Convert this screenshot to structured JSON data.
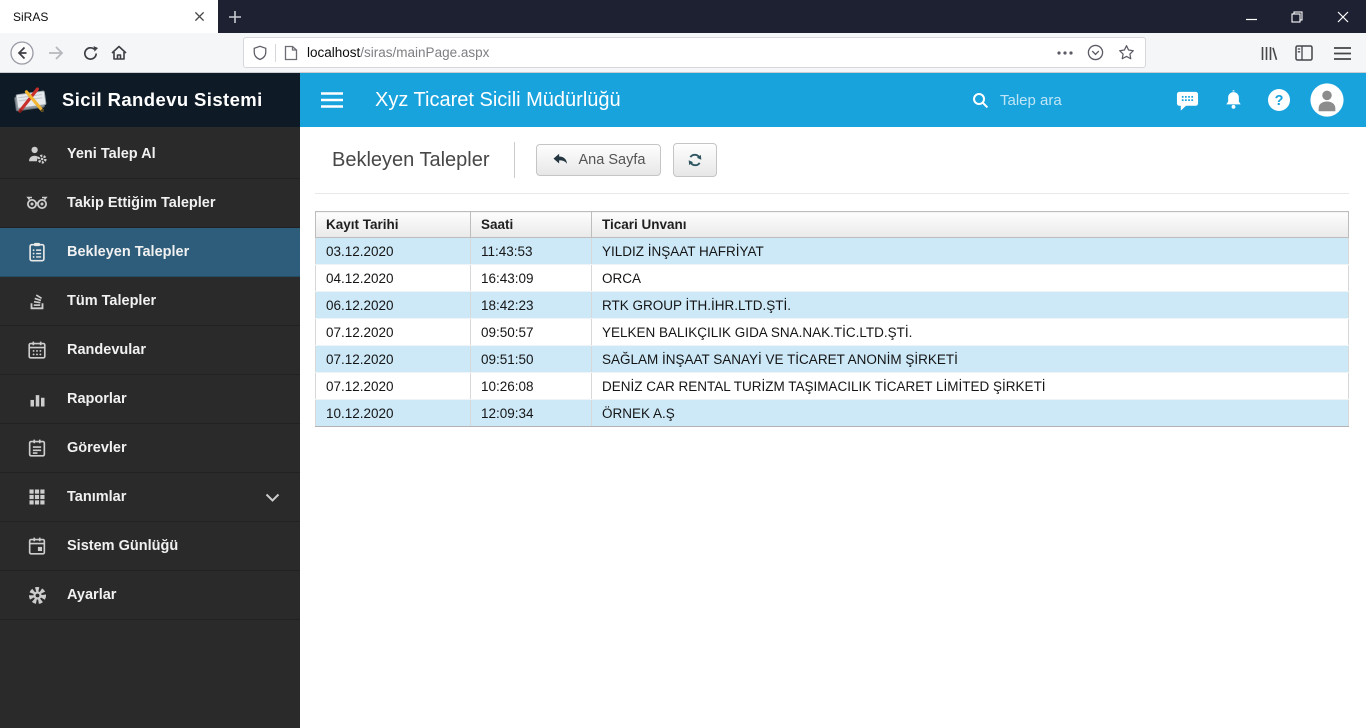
{
  "browser": {
    "tab_title": "SiRAS",
    "url": {
      "host": "localhost",
      "path": "/siras/mainPage.aspx"
    }
  },
  "appbar": {
    "title": "Xyz Ticaret Sicili Müdürlüğü",
    "search_placeholder": "Talep ara"
  },
  "sidebar": {
    "brand": "Sicil Randevu Sistemi",
    "items": [
      {
        "label": "Yeni Talep Al",
        "icon": "user-add-icon"
      },
      {
        "label": "Takip Ettiğim Talepler",
        "icon": "binoculars-icon"
      },
      {
        "label": "Bekleyen Talepler",
        "icon": "clipboard-list-icon",
        "active": true
      },
      {
        "label": "Tüm Talepler",
        "icon": "stack-icon"
      },
      {
        "label": "Randevular",
        "icon": "calendar-icon"
      },
      {
        "label": "Raporlar",
        "icon": "bar-chart-icon"
      },
      {
        "label": "Görevler",
        "icon": "tasks-icon"
      },
      {
        "label": "Tanımlar",
        "icon": "grid-icon",
        "expandable": true
      },
      {
        "label": "Sistem Günlüğü",
        "icon": "calendar-log-icon"
      },
      {
        "label": "Ayarlar",
        "icon": "gear-icon"
      }
    ]
  },
  "content": {
    "page_title": "Bekleyen Talepler",
    "home_button_label": "Ana Sayfa",
    "table": {
      "columns": [
        "Kayıt Tarihi",
        "Saati",
        "Ticari Unvanı"
      ],
      "rows": [
        [
          "03.12.2020",
          "11:43:53",
          "YILDIZ İNŞAAT HAFRİYAT"
        ],
        [
          "04.12.2020",
          "16:43:09",
          "ORCA"
        ],
        [
          "06.12.2020",
          "18:42:23",
          "RTK GROUP İTH.İHR.LTD.ŞTİ."
        ],
        [
          "07.12.2020",
          "09:50:57",
          "YELKEN BALIKÇILIK GIDA SNA.NAK.TİC.LTD.ŞTİ."
        ],
        [
          "07.12.2020",
          "09:51:50",
          "SAĞLAM İNŞAAT SANAYİ VE TİCARET ANONİM ŞİRKETİ"
        ],
        [
          "07.12.2020",
          "10:26:08",
          "DENİZ CAR RENTAL TURİZM TAŞIMACILIK TİCARET LİMİTED ŞİRKETİ"
        ],
        [
          "10.12.2020",
          "12:09:34",
          "ÖRNEK A.Ş"
        ]
      ]
    }
  },
  "icons": {
    "help_glyph": "?",
    "newtab_glyph": "+"
  },
  "colors": {
    "titlebar": "#1e2132",
    "appbar_blue": "#19a3dd",
    "sidebar_bg": "#2a2a2a",
    "sidebar_active": "#2d5d7b",
    "brand_bg": "#0e1a25",
    "row_alt": "#cde9f8"
  }
}
